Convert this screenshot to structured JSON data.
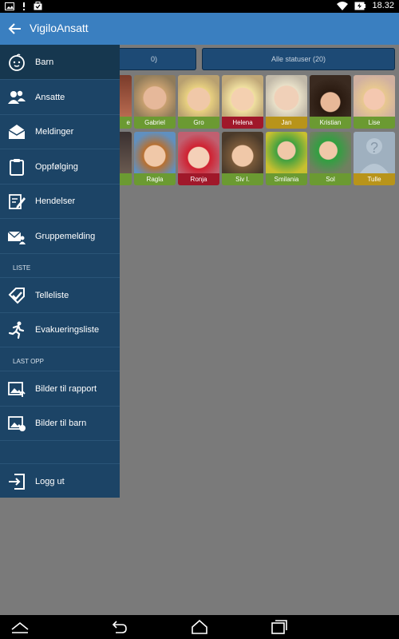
{
  "status_bar": {
    "time": "18.32"
  },
  "app_bar": {
    "title": "VigiloAnsatt"
  },
  "filters": {
    "left_fragment": "0)",
    "right": "Alle statuser (20)"
  },
  "children_row1": [
    "e",
    "Gabriel",
    "Gro",
    "Helena",
    "Jan",
    "Kristian",
    "Lise"
  ],
  "children_row2": [
    "",
    "Ragla",
    "Ronja",
    "Siv I.",
    "Smilania",
    "Sol",
    "Tulle"
  ],
  "colors": {
    "green_bar": "#6b9a32",
    "red_bar": "#a0182a",
    "yellow_bar": "#b8941a",
    "drawer_bg": "#1c4466",
    "app_bar": "#3a7fc0"
  },
  "drawer": {
    "items": [
      {
        "label": "Barn",
        "icon": "baby-face-icon"
      },
      {
        "label": "Ansatte",
        "icon": "people-icon"
      },
      {
        "label": "Meldinger",
        "icon": "envelope-open-icon"
      },
      {
        "label": "Oppfølging",
        "icon": "clipboard-icon"
      },
      {
        "label": "Hendelser",
        "icon": "edit-note-icon"
      },
      {
        "label": "Gruppemelding",
        "icon": "mail-group-icon"
      }
    ],
    "section_liste": "LISTE",
    "liste_items": [
      {
        "label": "Telleliste",
        "icon": "check-tag-icon"
      },
      {
        "label": "Evakueringsliste",
        "icon": "running-person-icon"
      }
    ],
    "section_last_opp": "LAST OPP",
    "upload_items": [
      {
        "label": "Bilder til rapport",
        "icon": "image-upload-icon"
      },
      {
        "label": "Bilder til barn",
        "icon": "image-child-icon"
      }
    ],
    "logout": {
      "label": "Logg ut",
      "icon": "logout-icon"
    }
  }
}
